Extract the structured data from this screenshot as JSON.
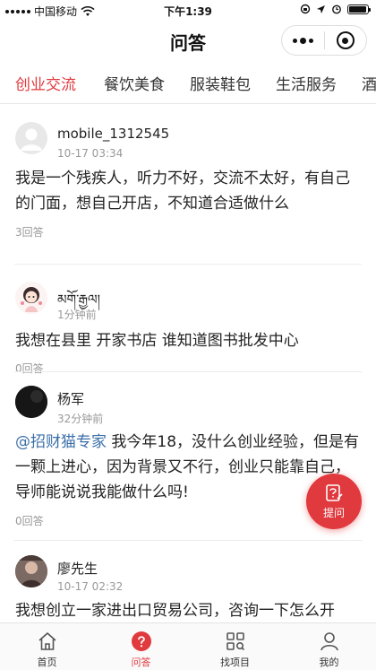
{
  "status_bar": {
    "carrier": "中国移动",
    "time": "下午1:39",
    "battery_level": 0.95
  },
  "nav": {
    "title": "问答"
  },
  "category_tabs": [
    {
      "label": "创业交流",
      "active": true
    },
    {
      "label": "餐饮美食",
      "active": false
    },
    {
      "label": "服装鞋包",
      "active": false
    },
    {
      "label": "生活服务",
      "active": false
    },
    {
      "label": "酒",
      "active": false
    }
  ],
  "posts": [
    {
      "username": "mobile_1312545",
      "time": "10-17 03:34",
      "mention": "",
      "text": "我是一个残疾人，听力不好，交流不太好，有自己的门面，想自己开店，不知道合适做什么",
      "answers": "3回答"
    },
    {
      "username": "མགོ་རྒྱལ།",
      "time": "1分钟前",
      "mention": "",
      "text": "我想在县里 开家书店 谁知道图书批发中心",
      "answers": "0回答"
    },
    {
      "username": "杨军",
      "time": "32分钟前",
      "mention": "@招财猫专家",
      "text": "我今年18，没什么创业经验，但是有一颗上进心，因为背景又不行，创业只能靠自己，导师能说说我能做什么吗!",
      "answers": "0回答"
    },
    {
      "username": "廖先生",
      "time": "10-17 02:32",
      "mention": "",
      "text": "我想创立一家进出口贸易公司，咨询一下怎么开",
      "answers": ""
    }
  ],
  "ask_button": {
    "label": "提问"
  },
  "tabbar": [
    {
      "label": "首页",
      "icon": "home-icon",
      "active": false
    },
    {
      "label": "问答",
      "icon": "question-icon",
      "active": true
    },
    {
      "label": "找项目",
      "icon": "grid-search-icon",
      "active": false
    },
    {
      "label": "我的",
      "icon": "user-icon",
      "active": false
    }
  ],
  "colors": {
    "accent": "#e0393e",
    "mention": "#3b6ea8",
    "muted": "#999999"
  }
}
